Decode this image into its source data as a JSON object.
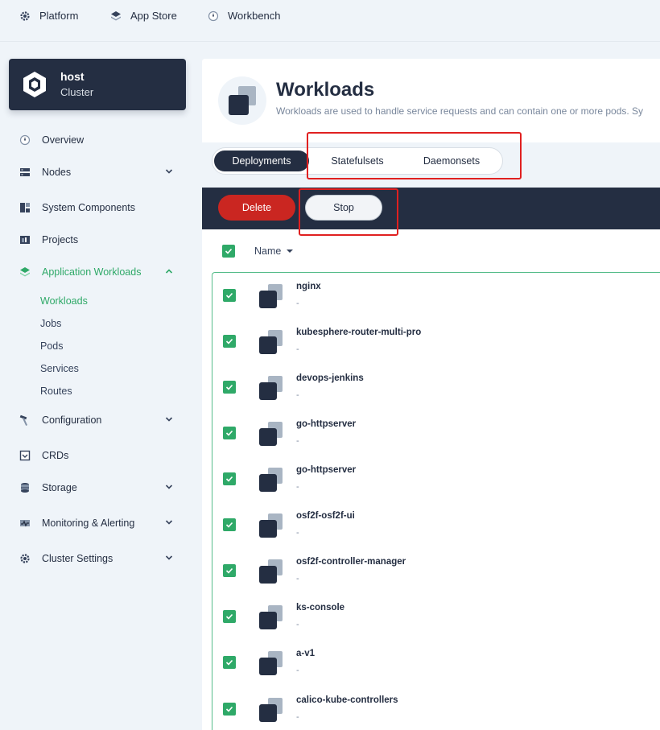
{
  "topnav": {
    "items": [
      {
        "label": "Platform",
        "icon": "gear-icon"
      },
      {
        "label": "App Store",
        "icon": "layers-icon"
      },
      {
        "label": "Workbench",
        "icon": "dashboard-icon"
      }
    ]
  },
  "cluster": {
    "name": "host",
    "type": "Cluster"
  },
  "sidebar": {
    "items": [
      {
        "label": "Overview",
        "icon": "dashboard-icon"
      },
      {
        "label": "Nodes",
        "icon": "server-icon"
      },
      {
        "label": "System Components",
        "icon": "components-icon"
      },
      {
        "label": "Projects",
        "icon": "project-icon"
      },
      {
        "label": "Application Workloads",
        "icon": "layers-icon"
      },
      {
        "label": "Configuration",
        "icon": "hammer-icon"
      },
      {
        "label": "CRDs",
        "icon": "crd-icon"
      },
      {
        "label": "Storage",
        "icon": "database-icon"
      },
      {
        "label": "Monitoring & Alerting",
        "icon": "monitor-icon"
      },
      {
        "label": "Cluster Settings",
        "icon": "gear-icon"
      }
    ],
    "workload_subitems": [
      "Workloads",
      "Jobs",
      "Pods",
      "Services",
      "Routes"
    ],
    "active_subitem": "Workloads"
  },
  "page": {
    "title": "Workloads",
    "description": "Workloads are used to handle service requests and can contain one or more pods. Sy"
  },
  "tabs": [
    "Deployments",
    "Statefulsets",
    "Daemonsets"
  ],
  "active_tab": "Deployments",
  "toolbar": {
    "delete_label": "Delete",
    "stop_label": "Stop"
  },
  "table": {
    "name_header": "Name",
    "rows": [
      {
        "name": "nginx",
        "sub": "-"
      },
      {
        "name": "kubesphere-router-multi-pro",
        "sub": "-"
      },
      {
        "name": "devops-jenkins",
        "sub": "-"
      },
      {
        "name": "go-httpserver",
        "sub": "-"
      },
      {
        "name": "go-httpserver",
        "sub": "-"
      },
      {
        "name": "osf2f-osf2f-ui",
        "sub": "-"
      },
      {
        "name": "osf2f-controller-manager",
        "sub": "-"
      },
      {
        "name": "ks-console",
        "sub": "-"
      },
      {
        "name": "a-v1",
        "sub": "-"
      },
      {
        "name": "calico-kube-controllers",
        "sub": "-"
      }
    ]
  },
  "colors": {
    "accent": "#55bc8a",
    "dark": "#242e42",
    "danger": "#ca2621",
    "highlight": "#e02020"
  }
}
